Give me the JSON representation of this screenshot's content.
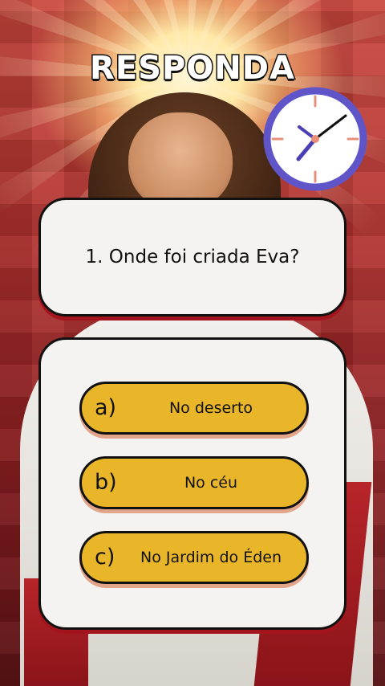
{
  "title": "RESPONDA",
  "question": "1. Onde foi criada Eva?",
  "options": [
    {
      "letter": "a)",
      "text": "No deserto"
    },
    {
      "letter": "b)",
      "text": "No céu"
    },
    {
      "letter": "c)",
      "text": "No Jardim do Éden"
    }
  ],
  "icons": {
    "clock": "clock-icon"
  },
  "colors": {
    "option_fill": "#e9b62a",
    "card_fill": "#f4f3f1",
    "clock_ring": "#5f55c9",
    "clock_tick": "#e88f7a",
    "clock_hand": "#4a3fb5"
  }
}
